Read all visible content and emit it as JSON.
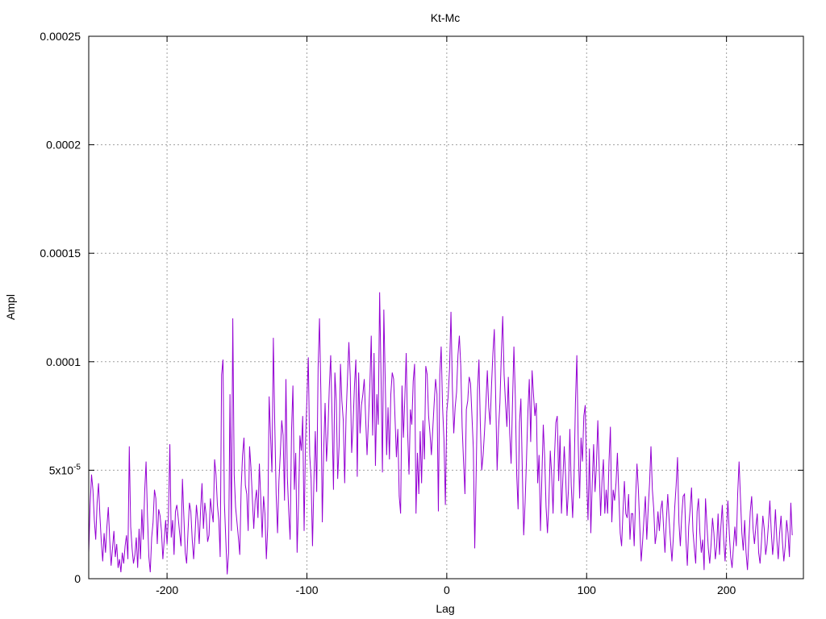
{
  "chart_data": {
    "type": "line",
    "title": "Kt-Mc",
    "xlabel": "Lag",
    "ylabel": "Ampl",
    "xlim": [
      -256,
      255
    ],
    "ylim": [
      0,
      0.00025
    ],
    "grid": true,
    "legend": "none",
    "series": [
      {
        "color": "#9400D3",
        "x_start": -256,
        "x_step": 1,
        "values": [
          1.2e-05,
          3.4e-05,
          4.8e-05,
          4.1e-05,
          2.7e-05,
          1.8e-05,
          3.5e-05,
          4.4e-05,
          2.9e-05,
          1.7e-05,
          8e-06,
          2.1e-05,
          1.2e-05,
          2.4e-05,
          3.3e-05,
          1.8e-05,
          6e-06,
          1.4e-05,
          2.2e-05,
          1e-05,
          1.6e-05,
          5e-06,
          9e-06,
          3e-06,
          1.2e-05,
          7e-06,
          1.5e-05,
          2e-05,
          9e-06,
          6.1e-05,
          2.4e-05,
          1.4e-05,
          7e-06,
          1.1e-05,
          1.9e-05,
          5e-06,
          2.3e-05,
          9e-06,
          3.2e-05,
          1.8e-05,
          4e-05,
          5.4e-05,
          2.9e-05,
          1e-05,
          3e-06,
          1.9e-05,
          2.6e-05,
          4.1e-05,
          3.7e-05,
          1.6e-05,
          3.2e-05,
          2.9e-05,
          2.2e-05,
          9e-06,
          1.8e-05,
          2.7e-05,
          1.6e-05,
          2.9e-05,
          6.2e-05,
          1.9e-05,
          2.7e-05,
          1.1e-05,
          3.1e-05,
          3.4e-05,
          2.8e-05,
          2.1e-05,
          1.5e-05,
          4.6e-05,
          2.9e-05,
          1.2e-05,
          7e-06,
          2.2e-05,
          3.5e-05,
          3.1e-05,
          1.8e-05,
          9e-06,
          2e-05,
          3.4e-05,
          2.7e-05,
          1.6e-05,
          3.2e-05,
          4.4e-05,
          2.3e-05,
          3.5e-05,
          2.9e-05,
          1.7e-05,
          2e-05,
          3.7e-05,
          3.1e-05,
          2.6e-05,
          5.5e-05,
          4.8e-05,
          3.4e-05,
          2.7e-05,
          1e-05,
          9.4e-05,
          0.000101,
          3.5e-05,
          1.8e-05,
          2e-06,
          1.2e-05,
          8.5e-05,
          2.2e-05,
          0.00012,
          4.8e-05,
          3.3e-05,
          2.6e-05,
          1.9e-05,
          1.1e-05,
          4.2e-05,
          5.7e-05,
          6.5e-05,
          4.3e-05,
          3.9e-05,
          2.2e-05,
          6.1e-05,
          5.1e-05,
          3.7e-05,
          2.3e-05,
          3.6e-05,
          4.1e-05,
          2.8e-05,
          5.3e-05,
          3.7e-05,
          1.9e-05,
          3.8e-05,
          3e-05,
          9e-06,
          2.4e-05,
          8.4e-05,
          6.6e-05,
          4.9e-05,
          0.000111,
          7.2e-05,
          3.9e-05,
          2.1e-05,
          4.5e-05,
          5.8e-05,
          7.3e-05,
          6.6e-05,
          3.6e-05,
          9.2e-05,
          4.7e-05,
          3.1e-05,
          1.8e-05,
          6.8e-05,
          8.9e-05,
          4.1e-05,
          5.8e-05,
          1.2e-05,
          3.5e-05,
          6.6e-05,
          5.9e-05,
          7.5e-05,
          2.2e-05,
          6.3e-05,
          8.3e-05,
          0.000102,
          5.7e-05,
          4.6e-05,
          1.5e-05,
          4.5e-05,
          6.8e-05,
          4e-05,
          9.7e-05,
          0.00012,
          8.5e-05,
          2.6e-05,
          5.9e-05,
          8.1e-05,
          5.4e-05,
          6.7e-05,
          8.8e-05,
          0.000103,
          7.4e-05,
          4.1e-05,
          9.5e-05,
          8.2e-05,
          4.6e-05,
          6.1e-05,
          9.9e-05,
          8.2e-05,
          7.3e-05,
          4.4e-05,
          7.5e-05,
          9.2e-05,
          0.000109,
          9.3e-05,
          5.8e-05,
          7.1e-05,
          8.9e-05,
          0.000101,
          4.7e-05,
          9.5e-05,
          6.7e-05,
          8e-05,
          8.5e-05,
          9.2e-05,
          7.4e-05,
          5.7e-05,
          7.3e-05,
          8.9e-05,
          0.000112,
          6.6e-05,
          0.000104,
          5.2e-05,
          8.5e-05,
          7.1e-05,
          0.000132,
          9.3e-05,
          4.9e-05,
          0.000124,
          9.1e-05,
          5.7e-05,
          7.9e-05,
          5.5e-05,
          8.5e-05,
          9.5e-05,
          9.2e-05,
          7.4e-05,
          5.6e-05,
          6.9e-05,
          3.8e-05,
          3e-05,
          8.9e-05,
          6.5e-05,
          8.3e-05,
          0.000104,
          6.8e-05,
          4.8e-05,
          7.8e-05,
          7.1e-05,
          9.1e-05,
          9.9e-05,
          3e-05,
          5.8e-05,
          3.9e-05,
          6.8e-05,
          4.4e-05,
          7.3e-05,
          5.5e-05,
          9.8e-05,
          9.4e-05,
          7.5e-05,
          6.7e-05,
          5.7e-05,
          6.9e-05,
          8.1e-05,
          9.2e-05,
          8.5e-05,
          3.1e-05,
          9.4e-05,
          0.000107,
          7.9e-05,
          6.4e-05,
          3.4e-05,
          7.7e-05,
          8.4e-05,
          9.7e-05,
          0.000123,
          8.8e-05,
          6.7e-05,
          7.9e-05,
          8.6e-05,
          0.000103,
          0.000112,
          9.8e-05,
          7e-05,
          5.4e-05,
          3.9e-05,
          7.8e-05,
          8.2e-05,
          9.3e-05,
          9e-05,
          7.5e-05,
          6e-05,
          1.4e-05,
          4.8e-05,
          8.7e-05,
          0.000101,
          7.1e-05,
          5e-05,
          5.7e-05,
          6.8e-05,
          8.1e-05,
          9.6e-05,
          7.9e-05,
          7.1e-05,
          8.9e-05,
          0.000104,
          0.000115,
          8.3e-05,
          5e-05,
          6.9e-05,
          8.1e-05,
          0.000103,
          0.000121,
          9.4e-05,
          8.1e-05,
          7e-05,
          9.3e-05,
          6.7e-05,
          5.3e-05,
          8.1e-05,
          0.000107,
          8.4e-05,
          4.8e-05,
          3.2e-05,
          7.2e-05,
          8.3e-05,
          5e-05,
          2e-05,
          3.5e-05,
          5.5e-05,
          7.7e-05,
          9.2e-05,
          6.3e-05,
          9.6e-05,
          8.5e-05,
          7.5e-05,
          8.1e-05,
          4.4e-05,
          5.7e-05,
          2.2e-05,
          4.7e-05,
          7.1e-05,
          5.6e-05,
          3.3e-05,
          2.1e-05,
          3.5e-05,
          5.9e-05,
          4.8e-05,
          3e-05,
          5.6e-05,
          7.2e-05,
          7.5e-05,
          4.5e-05,
          6.6e-05,
          3e-05,
          4.6e-05,
          6.1e-05,
          4.7e-05,
          2.9e-05,
          4.1e-05,
          6.9e-05,
          4.3e-05,
          2.8e-05,
          4.7e-05,
          8.1e-05,
          0.000103,
          6.2e-05,
          3.7e-05,
          6.5e-05,
          5.4e-05,
          7.5e-05,
          8e-05,
          4.7e-05,
          2.7e-05,
          6e-05,
          2.1e-05,
          4.4e-05,
          6.2e-05,
          4e-05,
          5.2e-05,
          7.3e-05,
          5.1e-05,
          2.9e-05,
          4.5e-05,
          5.5e-05,
          3e-05,
          4.1e-05,
          3e-05,
          5.4e-05,
          7e-05,
          2.6e-05,
          4.1e-05,
          3.6e-05,
          4.4e-05,
          5.8e-05,
          3.9e-05,
          2.1e-05,
          1.5e-05,
          3.1e-05,
          4.5e-05,
          3e-05,
          2.8e-05,
          3.9e-05,
          1.8e-05,
          3e-05,
          3e-05,
          1.5e-05,
          3.7e-05,
          5.3e-05,
          4.1e-05,
          2.4e-05,
          8e-06,
          1.7e-05,
          2.8e-05,
          3.8e-05,
          1.8e-05,
          3.2e-05,
          4.4e-05,
          6.1e-05,
          4.1e-05,
          3.2e-05,
          1.6e-05,
          2.1e-05,
          3.1e-05,
          2.2e-05,
          3.2e-05,
          3.6e-05,
          2.4e-05,
          1.2e-05,
          2.7e-05,
          3.9e-05,
          2.7e-05,
          1.7e-05,
          8e-06,
          1.9e-05,
          3.3e-05,
          4.3e-05,
          5.6e-05,
          2.6e-05,
          1.5e-05,
          2.9e-05,
          3.8e-05,
          3.9e-05,
          1.8e-05,
          6e-06,
          2.4e-05,
          3.2e-05,
          4.2e-05,
          2.2e-05,
          1.4e-05,
          7e-06,
          3.1e-05,
          3.7e-05,
          2.1e-05,
          1.2e-05,
          1.8e-05,
          4e-06,
          3.7e-05,
          2.5e-05,
          1.4e-05,
          7e-06,
          1.6e-05,
          2.8e-05,
          2.1e-05,
          9e-06,
          1.5e-05,
          3e-05,
          1.1e-05,
          2.4e-05,
          3.4e-05,
          1.8e-05,
          8e-06,
          2.2e-05,
          3.6e-05,
          2.1e-05,
          1e-05,
          5e-06,
          1.5e-05,
          2.4e-05,
          1.5e-05,
          3.9e-05,
          5.4e-05,
          3.7e-05,
          2.1e-05,
          1.3e-05,
          2.7e-05,
          1.2e-05,
          4e-06,
          1.8e-05,
          3.1e-05,
          3.8e-05,
          2.3e-05,
          1.6e-05,
          2.4e-05,
          3e-05,
          1.2e-05,
          7e-06,
          1.7e-05,
          2.9e-05,
          2.3e-05,
          1.1e-05,
          1.6e-05,
          2.5e-05,
          3.6e-05,
          2.2e-05,
          1.1e-05,
          1.9e-05,
          3.2e-05,
          1.8e-05,
          9e-06,
          2.1e-05,
          2.9e-05,
          1.7e-05,
          8e-06,
          1.5e-05,
          2.7e-05,
          2.1e-05,
          1e-05,
          3.5e-05,
          2e-05
        ]
      }
    ]
  }
}
